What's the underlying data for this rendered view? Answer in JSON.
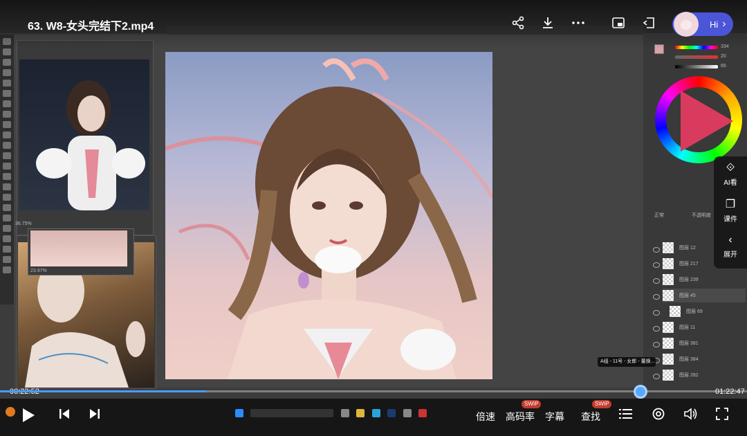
{
  "video": {
    "title": "63. W8-女头完结下2.mp4",
    "current_time": "00:22:52",
    "total_time": "01:22:47",
    "progress": 0.2763,
    "hi_label": "Hi",
    "chevron": "›",
    "tooltip": "A组 - 11号 - 女郎 - 董焕..."
  },
  "side_menu": [
    {
      "icon": "ai-look-icon",
      "glyph": "⟐",
      "label": "AI看"
    },
    {
      "icon": "courseware-icon",
      "glyph": "❐",
      "label": "课件"
    },
    {
      "icon": "expand-icon",
      "glyph": "‹",
      "label": "展开"
    }
  ],
  "controls": {
    "speed": "倍速",
    "bitrate": "高码率",
    "subtitle": "字幕",
    "search": "查找",
    "swip_badge": "SWIP"
  },
  "photoshop": {
    "zoom_ref1": "36.75%",
    "zoom_nav": "23.97%",
    "blend_mode": "正常",
    "opacity_label": "不透明度",
    "color_values": [
      "334",
      "20",
      "65"
    ],
    "layers": [
      "图层 12",
      "图层 217",
      "图层 239",
      "图层 45",
      "图层 69",
      "图层 11",
      "图层 381",
      "图层 384",
      "图层 282"
    ]
  },
  "colors": {
    "accent": "#4a9cff",
    "hi_pill": "#4b55d8"
  }
}
